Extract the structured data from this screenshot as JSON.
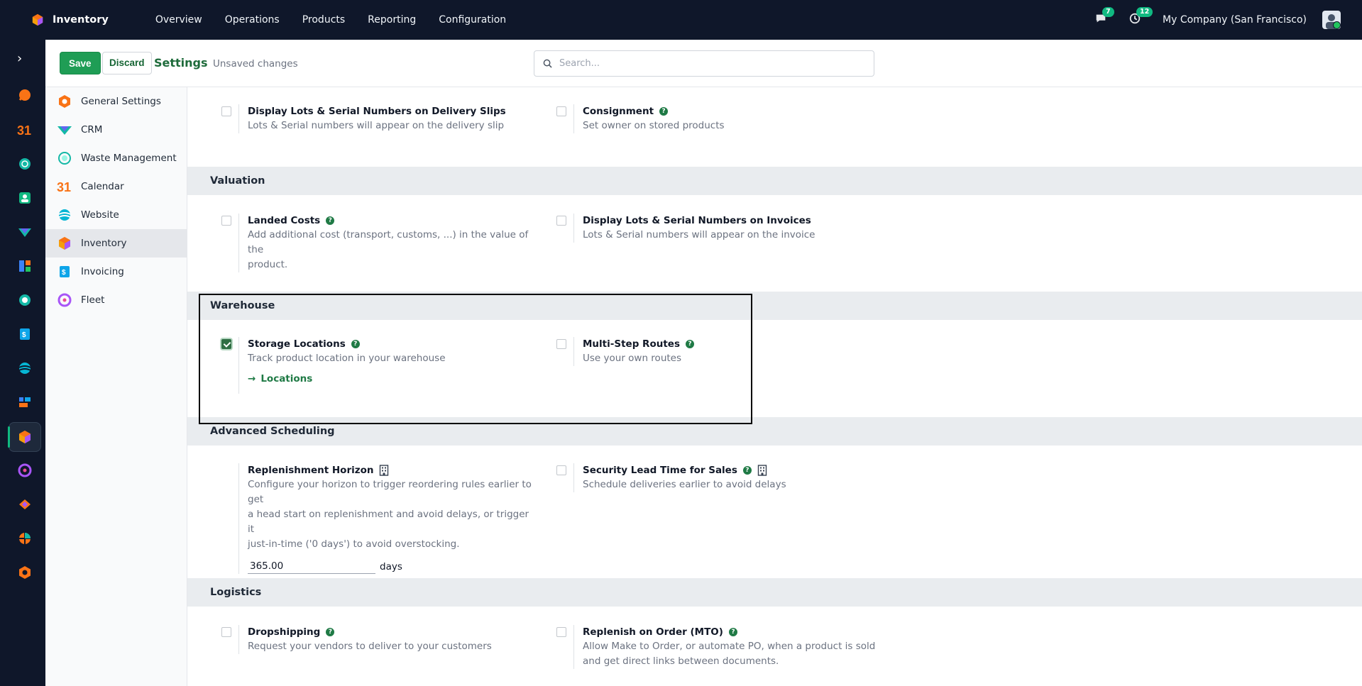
{
  "navbar": {
    "app_name": "Inventory",
    "menu": [
      "Overview",
      "Operations",
      "Products",
      "Reporting",
      "Configuration"
    ],
    "messages_count": "7",
    "activities_count": "12",
    "company": "My Company (San Francisco)"
  },
  "control_panel": {
    "save_label": "Save",
    "discard_label": "Discard",
    "title": "Settings",
    "status": "Unsaved changes",
    "search_placeholder": "Search..."
  },
  "sidebar": {
    "items": [
      {
        "label": "General Settings",
        "icon": "settings-app-icon"
      },
      {
        "label": "CRM",
        "icon": "crm-icon"
      },
      {
        "label": "Waste Management",
        "icon": "waste-icon"
      },
      {
        "label": "Calendar",
        "icon": "calendar-icon"
      },
      {
        "label": "Website",
        "icon": "website-icon"
      },
      {
        "label": "Inventory",
        "icon": "inventory-icon",
        "active": true
      },
      {
        "label": "Invoicing",
        "icon": "invoicing-icon"
      },
      {
        "label": "Fleet",
        "icon": "fleet-icon"
      }
    ]
  },
  "content": {
    "top_settings": {
      "lots_delivery": {
        "title": "Display Lots & Serial Numbers on Delivery Slips",
        "desc": "Lots & Serial numbers will appear on the delivery slip",
        "checked": false
      },
      "consignment": {
        "title": "Consignment",
        "desc": "Set owner on stored products",
        "checked": false
      }
    },
    "valuation": {
      "heading": "Valuation",
      "landed_costs": {
        "title": "Landed Costs",
        "desc_line1": "Add additional cost (transport, customs, ...) in the value of the",
        "desc_line2": "product.",
        "checked": false
      },
      "lots_invoices": {
        "title": "Display Lots & Serial Numbers on Invoices",
        "desc": "Lots & Serial numbers will appear on the invoice",
        "checked": false
      }
    },
    "warehouse": {
      "heading": "Warehouse",
      "storage_locations": {
        "title": "Storage Locations",
        "desc": "Track product location in your warehouse",
        "checked": true,
        "link": "Locations"
      },
      "multi_step": {
        "title": "Multi-Step Routes",
        "desc": "Use your own routes",
        "checked": false
      }
    },
    "advanced_scheduling": {
      "heading": "Advanced Scheduling",
      "replenishment": {
        "title": "Replenishment Horizon",
        "desc_line1": "Configure your horizon to trigger reordering rules earlier to get",
        "desc_line2": "a head start on replenishment and avoid delays, or trigger it",
        "desc_line3": "just-in-time ('0 days') to avoid overstocking.",
        "value": "365.00",
        "unit": "days"
      },
      "security_lead": {
        "title": "Security Lead Time for Sales",
        "desc": "Schedule deliveries earlier to avoid delays",
        "checked": false
      }
    },
    "logistics": {
      "heading": "Logistics",
      "dropshipping": {
        "title": "Dropshipping",
        "desc": "Request your vendors to deliver to your customers",
        "checked": false
      },
      "mto": {
        "title": "Replenish on Order (MTO)",
        "desc_line1": "Allow Make to Order, or automate PO, when a product is sold",
        "desc_line2": "and get direct links between documents.",
        "checked": false
      }
    }
  }
}
